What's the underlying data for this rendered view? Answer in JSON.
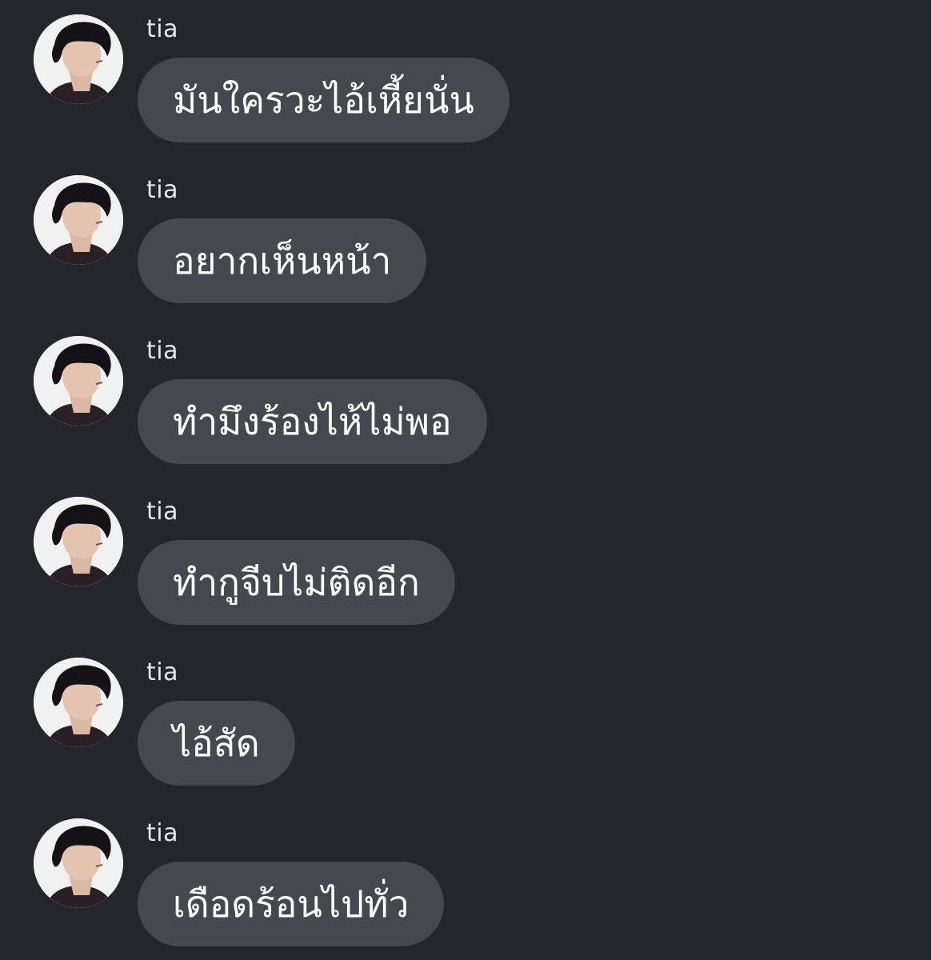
{
  "conversation": {
    "messages": [
      {
        "sender": "tia",
        "avatar_icon": "profile-photo",
        "text": "มันใครวะไอ้เหี้ยนั่น"
      },
      {
        "sender": "tia",
        "avatar_icon": "profile-photo",
        "text": "อยากเห็นหน้า"
      },
      {
        "sender": "tia",
        "avatar_icon": "profile-photo",
        "text": "ทำมึงร้องไห้ไม่พอ"
      },
      {
        "sender": "tia",
        "avatar_icon": "profile-photo",
        "text": "ทำกูจีบไม่ติดอีก"
      },
      {
        "sender": "tia",
        "avatar_icon": "profile-photo",
        "text": "ไอ้สัด"
      },
      {
        "sender": "tia",
        "avatar_icon": "profile-photo",
        "text": "เดือดร้อนไปทั่ว"
      }
    ]
  },
  "colors": {
    "background": "#25252c",
    "bubble": "#47474f",
    "text": "#ffffff",
    "sender_text": "#e6e6ea"
  }
}
